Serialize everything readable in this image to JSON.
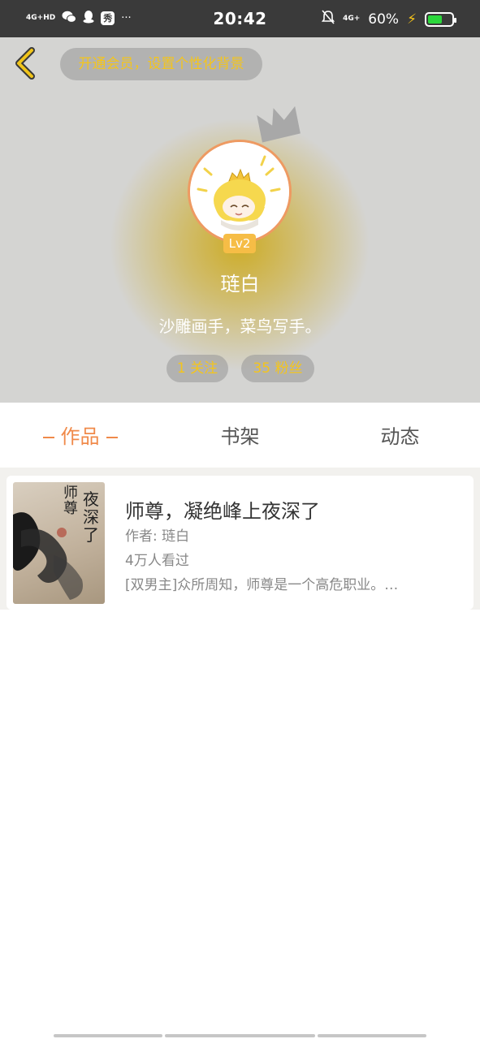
{
  "status_bar": {
    "network_left": "4G+HD",
    "time": "20:42",
    "network_right": "4G+",
    "battery_text": "60%",
    "battery_level": 0.6,
    "icons": [
      "signal-icon",
      "wechat-icon",
      "qq-icon",
      "app-icon",
      "more-icon",
      "mute-icon",
      "charging-icon",
      "battery-icon"
    ]
  },
  "header": {
    "vip_banner": "开通会员，设置个性化背景",
    "level": "Lv2",
    "username": "琏白",
    "bio": "沙雕画手，菜鸟写手。",
    "following": "1 关注",
    "followers": "35 粉丝",
    "accent_color": "#f4c51c"
  },
  "tabs": [
    {
      "label": "作品",
      "active": true
    },
    {
      "label": "书架",
      "active": false
    },
    {
      "label": "动态",
      "active": false
    }
  ],
  "works": [
    {
      "cover_title_1": "师尊",
      "cover_title_2": "夜深了",
      "title": "师尊，凝绝峰上夜深了",
      "author": "作者: 琏白",
      "views": "4万人看过",
      "description": "[双男主]众所周知，师尊是一个高危职业。…"
    }
  ]
}
